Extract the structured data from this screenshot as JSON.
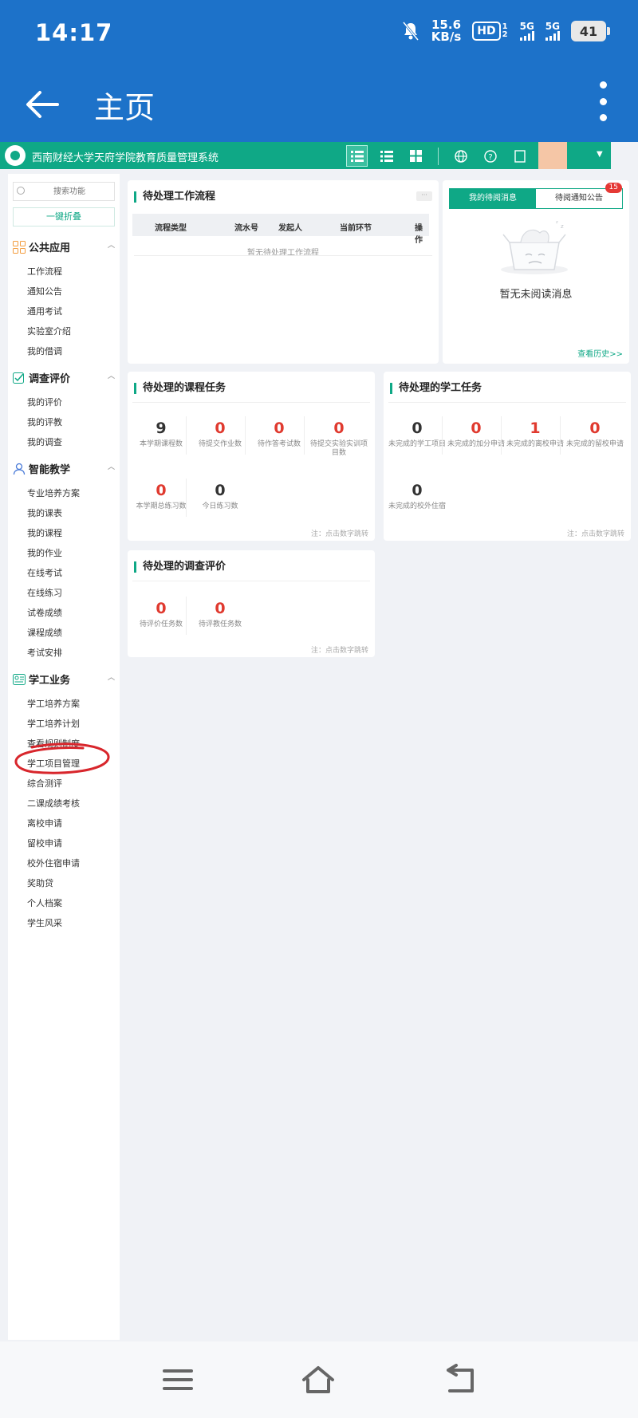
{
  "status_bar": {
    "time": "14:17",
    "net_speed_value": "15.6",
    "net_speed_unit": "KB/s",
    "hd": "HD",
    "hd_sub": "1 2",
    "sim1": "5G",
    "sim2": "5G",
    "battery": "41"
  },
  "appbar": {
    "title": "主页"
  },
  "web_header": {
    "system_title": "西南财经大学天府学院教育质量管理系统"
  },
  "sidebar": {
    "search_placeholder": "搜索功能",
    "collapse_label": "一键折叠",
    "groups": [
      {
        "title": "公共应用",
        "items": [
          "工作流程",
          "通知公告",
          "通用考试",
          "实验室介绍",
          "我的借调"
        ]
      },
      {
        "title": "调查评价",
        "items": [
          "我的评价",
          "我的评教",
          "我的调查"
        ]
      },
      {
        "title": "智能教学",
        "items": [
          "专业培养方案",
          "我的课表",
          "我的课程",
          "我的作业",
          "在线考试",
          "在线练习",
          "试卷成绩",
          "课程成绩",
          "考试安排"
        ]
      },
      {
        "title": "学工业务",
        "items": [
          "学工培养方案",
          "学工培养计划",
          "查看规则制度",
          "学工项目管理",
          "综合测评",
          "二课成绩考核",
          "离校申请",
          "留校申请",
          "校外住宿申请",
          "奖助贷",
          "个人档案",
          "学生风采"
        ]
      }
    ]
  },
  "workflow": {
    "title": "待处理工作流程",
    "more": "···",
    "columns": [
      "流程类型",
      "流水号",
      "发起人",
      "当前环节",
      "操作"
    ],
    "empty": "暂无待处理工作流程"
  },
  "messages": {
    "tab_active": "我的待阅消息",
    "tab_other": "待阅通知公告",
    "badge": "15",
    "empty": "暂无未阅读消息",
    "history_link": "查看历史>>"
  },
  "course_tasks": {
    "title": "待处理的课程任务",
    "stats": [
      {
        "value": "9",
        "label": "本学期课程数"
      },
      {
        "value": "0",
        "label": "待提交作业数"
      },
      {
        "value": "0",
        "label": "待作答考试数"
      },
      {
        "value": "0",
        "label": "待提交实验实训项目数"
      },
      {
        "value": "0",
        "label": "本学期总练习数"
      },
      {
        "value": "0",
        "label": "今日练习数"
      }
    ],
    "note": "注：点击数字跳转"
  },
  "student_tasks": {
    "title": "待处理的学工任务",
    "stats": [
      {
        "value": "0",
        "label": "未完成的学工项目"
      },
      {
        "value": "0",
        "label": "未完成的加分申请"
      },
      {
        "value": "1",
        "label": "未完成的离校申请"
      },
      {
        "value": "0",
        "label": "未完成的留校申请"
      },
      {
        "value": "0",
        "label": "未完成的校外住宿"
      }
    ],
    "note": "注：点击数字跳转"
  },
  "survey_tasks": {
    "title": "待处理的调查评价",
    "stats": [
      {
        "value": "0",
        "label": "待评价任务数"
      },
      {
        "value": "0",
        "label": "待评教任务数"
      }
    ],
    "note": "注：点击数字跳转"
  },
  "colors": {
    "status_bar": "#1d72c9",
    "accent": "#0fa886",
    "alert": "#e03a2f"
  }
}
